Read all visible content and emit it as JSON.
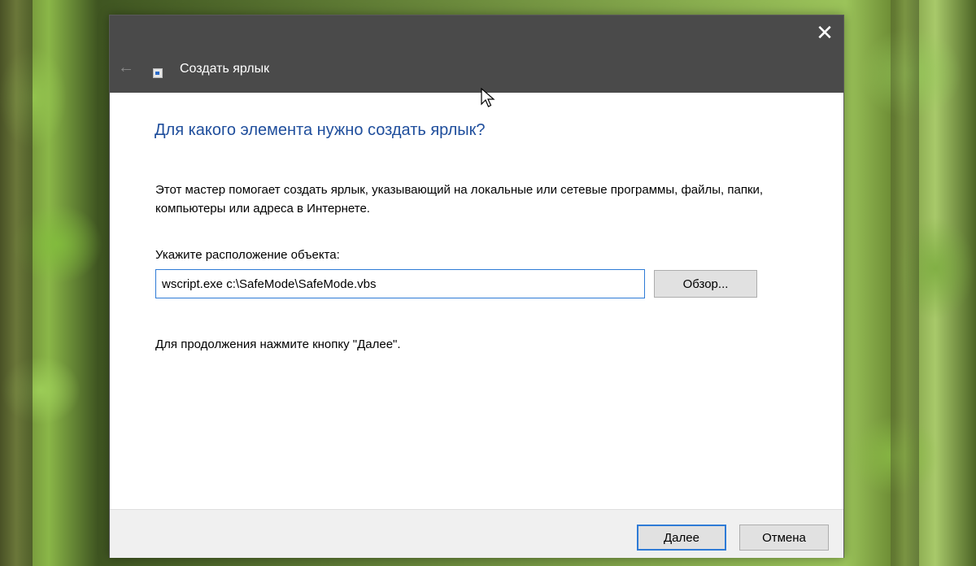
{
  "window": {
    "title": "Создать ярлык",
    "close_glyph": "✕",
    "back_glyph": "←",
    "titlebar_color": "#4a4a4a"
  },
  "content": {
    "heading": "Для какого элемента нужно создать ярлык?",
    "description": "Этот мастер помогает создать ярлык, указывающий на локальные или сетевые программы, файлы, папки, компьютеры или адреса в Интернете.",
    "location_label": "Укажите расположение объекта:",
    "location_value": "wscript.exe c:\\SafeMode\\SafeMode.vbs",
    "browse_label": "Обзор...",
    "continue_hint": "Для продолжения нажмите кнопку \"Далее\".",
    "heading_color": "#1f4e9c"
  },
  "footer": {
    "next_label": "Далее",
    "cancel_label": "Отмена",
    "accent_color": "#2e7bd6"
  },
  "icons": {
    "close": "close-icon",
    "back": "back-arrow-icon",
    "shortcut": "shortcut-icon",
    "cursor": "mouse-cursor-icon"
  }
}
